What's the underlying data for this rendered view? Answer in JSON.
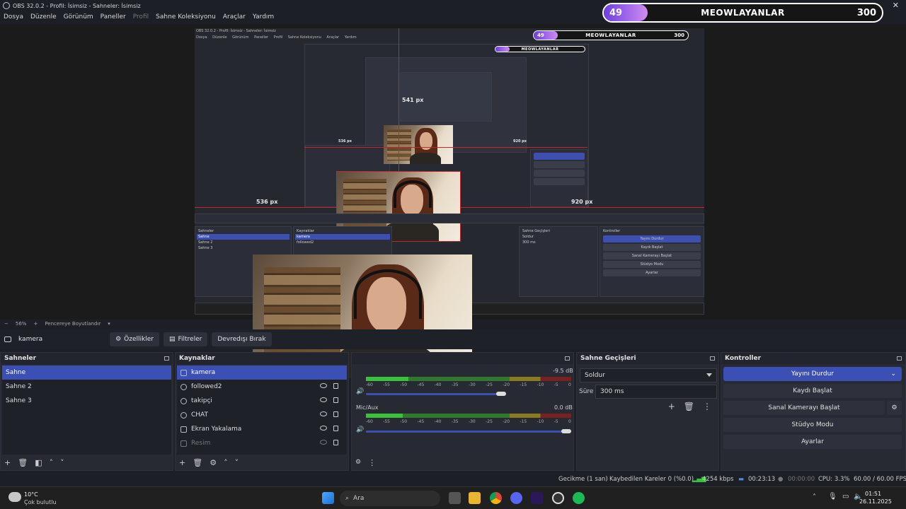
{
  "window": {
    "title": "OBS 32.0.2 - Profil: İsimsiz - Sahneler: İsimsiz"
  },
  "menu": [
    "Dosya",
    "Düzenle",
    "Görünüm",
    "Paneller",
    "Profil",
    "Sahne Koleksiyonu",
    "Araçlar",
    "Yardım"
  ],
  "goal_overlay": {
    "left_value": "49",
    "title": "MEOWLAYANLAR",
    "right_value": "300",
    "progress_fraction": 0.163
  },
  "preview": {
    "inner_title": "OBS 32.0.2 - Profil: İsimsiz - Sahneler: İsimsiz",
    "inner_menu": [
      "Dosya",
      "Düzenle",
      "Görünüm",
      "Paneller",
      "Profil",
      "Sahne Koleksiyonu",
      "Araçlar",
      "Yardım"
    ],
    "px_labels": {
      "top": "541 px",
      "left": "536 px",
      "right": "920 px",
      "inner_left": "536 px",
      "inner_right": "920 px"
    }
  },
  "zoom_row": {
    "minus": "−",
    "zoom": "56%",
    "plus": "+",
    "fit": "Pencereye Boyutlandır"
  },
  "source_toolbar": {
    "source_name": "kamera",
    "properties": "Özellikler",
    "filters": "Filtreler",
    "deactivate": "Devredışı Bırak"
  },
  "scenes": {
    "title": "Sahneler",
    "items": [
      "Sahne",
      "Sahne 2",
      "Sahne 3"
    ]
  },
  "sources": {
    "title": "Kaynaklar",
    "items": [
      {
        "name": "kamera",
        "icon": "camera-icon"
      },
      {
        "name": "followed2",
        "icon": "globe-icon"
      },
      {
        "name": "takipçi",
        "icon": "globe-icon"
      },
      {
        "name": "CHAT",
        "icon": "globe-icon"
      },
      {
        "name": "Ekran Yakalama",
        "icon": "monitor-icon"
      },
      {
        "name": "Resim",
        "icon": "image-icon"
      }
    ]
  },
  "mixer": {
    "track1_db": "-9.5 dB",
    "track2_name": "Mic/Aux",
    "track2_db": "0.0 dB",
    "scale": [
      "-60",
      "-55",
      "-50",
      "-45",
      "-40",
      "-35",
      "-30",
      "-25",
      "-20",
      "-15",
      "-10",
      "-5",
      "0"
    ],
    "track1_level": 0.82,
    "track2_level": 0.96
  },
  "transitions": {
    "title": "Sahne Geçişleri",
    "type": "Soldur",
    "duration_label": "Süre",
    "duration_value": "300 ms"
  },
  "controls": {
    "title": "Kontroller",
    "stop_stream": "Yayını Durdur",
    "start_record": "Kaydı Başlat",
    "virtual_cam": "Sanal Kamerayı Başlat",
    "studio_mode": "Stüdyo Modu",
    "settings": "Ayarlar"
  },
  "status": {
    "delay": "Gecikme (1 san)",
    "dropped": "Kaybedilen Kareler 0 (%0.0)",
    "bitrate": "4254 kbps",
    "stream_time": "00:23:13",
    "record_time": "00:00:00",
    "cpu": "CPU: 3.3%",
    "fps": "60.00 / 60.00 FPS"
  },
  "taskbar": {
    "weather_temp": "10°C",
    "weather_desc": "Çok bulutlu",
    "search_placeholder": "Ara",
    "time": "01:51",
    "date": "26.11.2025"
  },
  "colors": {
    "accent": "#3c4fb4",
    "selection_red": "#c0282b",
    "meter_green": "#39c23a"
  }
}
